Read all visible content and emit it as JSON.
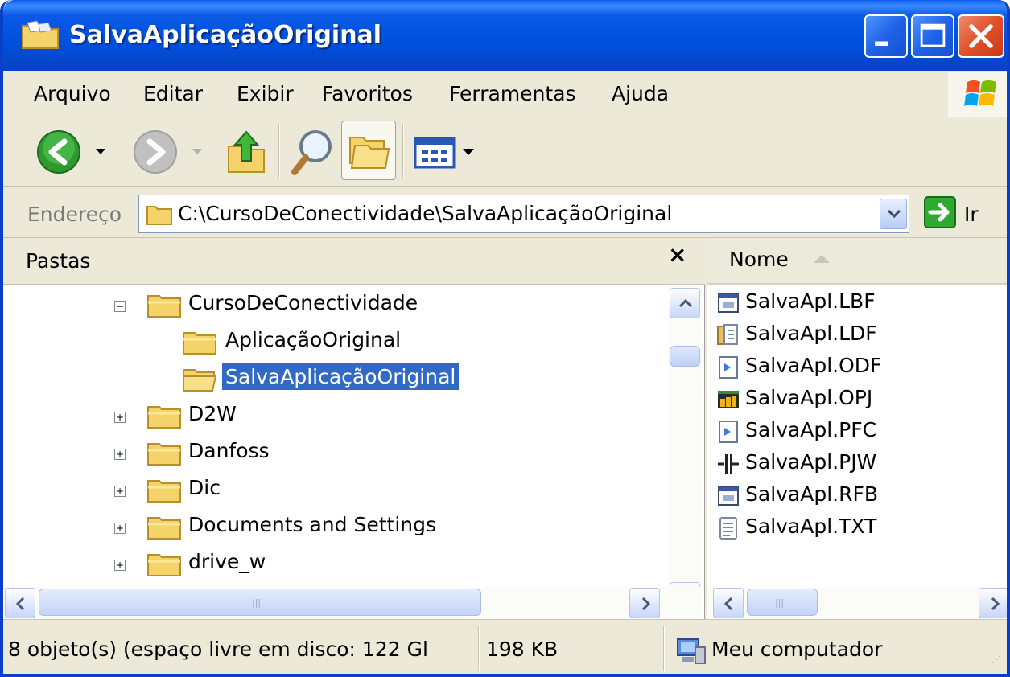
{
  "window": {
    "title": "SalvaAplicaçãoOriginal",
    "accent_color": "#0a5ae6",
    "close_color": "#e0502a"
  },
  "menubar": {
    "items": [
      {
        "label": "Arquivo"
      },
      {
        "label": "Editar"
      },
      {
        "label": "Exibir"
      },
      {
        "label": "Favoritos"
      },
      {
        "label": "Ferramentas"
      },
      {
        "label": "Ajuda"
      }
    ]
  },
  "toolbar": {
    "icons": [
      "back-arrow-icon",
      "forward-arrow-icon",
      "folder-up-icon",
      "search-icon",
      "folders-icon",
      "views-icon"
    ]
  },
  "address": {
    "label": "Endereço",
    "value": "C:\\CursoDeConectividade\\SalvaAplicaçãoOriginal",
    "go_label": "Ir"
  },
  "folders_pane": {
    "title": "Pastas",
    "close_label": "×",
    "tree": [
      {
        "label": "CursoDeConectividade",
        "toggle": "−",
        "selected": false
      },
      {
        "label": "AplicaçãoOriginal",
        "toggle": "",
        "selected": false
      },
      {
        "label": "SalvaAplicaçãoOriginal",
        "toggle": "",
        "selected": true
      },
      {
        "label": "D2W",
        "toggle": "+",
        "selected": false
      },
      {
        "label": "Danfoss",
        "toggle": "+",
        "selected": false
      },
      {
        "label": "Dic",
        "toggle": "+",
        "selected": false
      },
      {
        "label": "Documents and Settings",
        "toggle": "+",
        "selected": false
      },
      {
        "label": "drive_w",
        "toggle": "+",
        "selected": false
      }
    ],
    "selection_color": "#316ac5"
  },
  "files_pane": {
    "column_name": "Nome",
    "files": [
      {
        "name": "SalvaApl.LBF",
        "icon": "lbf-file-icon"
      },
      {
        "name": "SalvaApl.LDF",
        "icon": "ldf-file-icon"
      },
      {
        "name": "SalvaApl.ODF",
        "icon": "odf-file-icon"
      },
      {
        "name": "SalvaApl.OPJ",
        "icon": "opj-file-icon"
      },
      {
        "name": "SalvaApl.PFC",
        "icon": "pfc-file-icon"
      },
      {
        "name": "SalvaApl.PJW",
        "icon": "pjw-file-icon"
      },
      {
        "name": "SalvaApl.RFB",
        "icon": "rfb-file-icon"
      },
      {
        "name": "SalvaApl.TXT",
        "icon": "txt-file-icon"
      }
    ]
  },
  "statusbar": {
    "objects": "8 objeto(s) (espaço livre em disco:  122 Gl",
    "size": "198 KB",
    "location": "Meu computador"
  }
}
